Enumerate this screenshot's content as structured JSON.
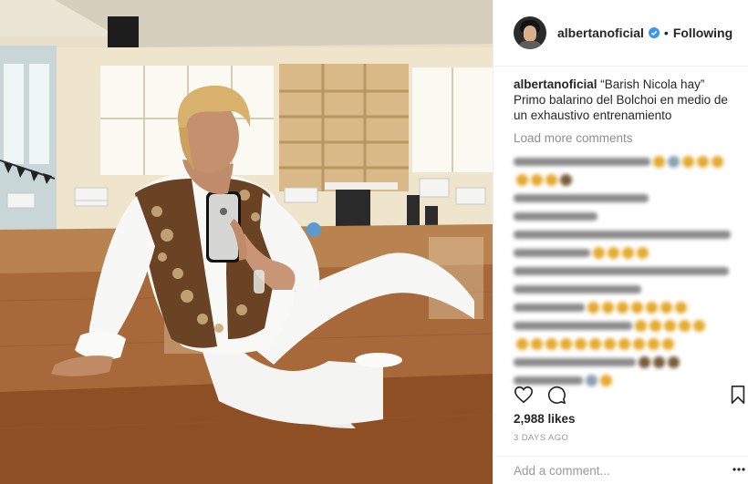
{
  "post": {
    "image_description": "",
    "username": "albertanoficial",
    "follow_state": "Following",
    "separator": "•",
    "caption_user": "albertanoficial",
    "caption_text": " “Barish Nicola hay” Primo balarino del Bolchoi en medio de un exhaustivo entrenamiento",
    "load_more": "Load more comments",
    "likes": "2,988 likes",
    "time": "3 DAYS AGO",
    "add_comment_placeholder": "Add a comment...",
    "more_options": "•••"
  },
  "icons": {
    "verified": "verified-badge-icon",
    "like": "heart-icon",
    "comment": "comment-bubble-icon",
    "save": "bookmark-icon",
    "more": "ellipsis-icon"
  },
  "colors": {
    "verified": "#3897f0",
    "text": "#262626",
    "muted": "#8e8e8e",
    "border": "#efefef"
  }
}
